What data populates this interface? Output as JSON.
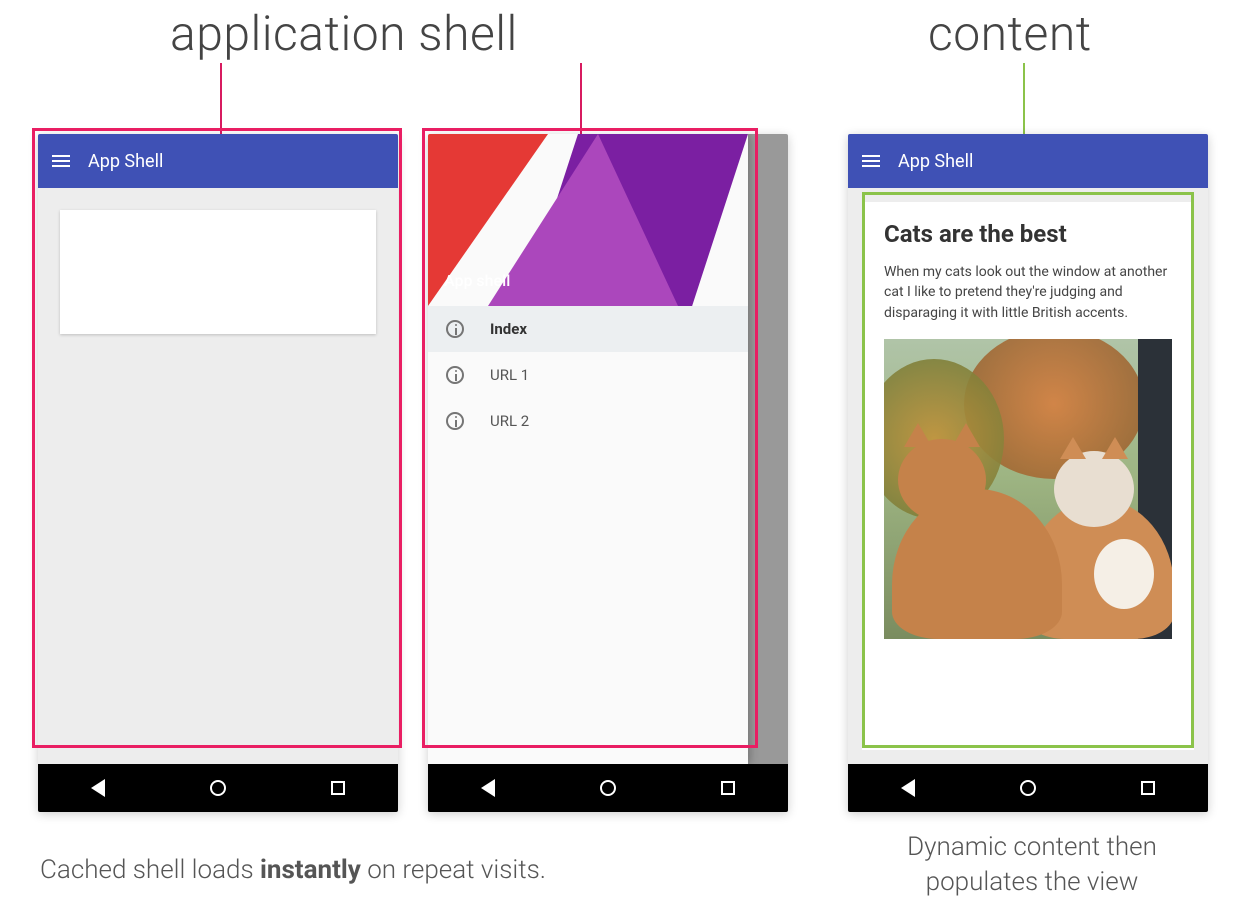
{
  "headings": {
    "shell": "application shell",
    "content": "content"
  },
  "appbar_title": "App Shell",
  "drawer": {
    "header": "App shell",
    "items": [
      {
        "label": "Index",
        "active": true
      },
      {
        "label": "URL 1",
        "active": false
      },
      {
        "label": "URL 2",
        "active": false
      }
    ]
  },
  "article": {
    "title": "Cats are the best",
    "body": "When my cats look out the window at another cat I like to pretend they're judging and disparaging it with little British accents."
  },
  "captions": {
    "shell_pre": "Cached shell loads ",
    "shell_strong": "instantly",
    "shell_post": " on repeat visits.",
    "content": "Dynamic content then populates the view"
  },
  "colors": {
    "appbar": "#3f51b5",
    "highlight_shell": "#e91e63",
    "highlight_content": "#8bc34a"
  }
}
